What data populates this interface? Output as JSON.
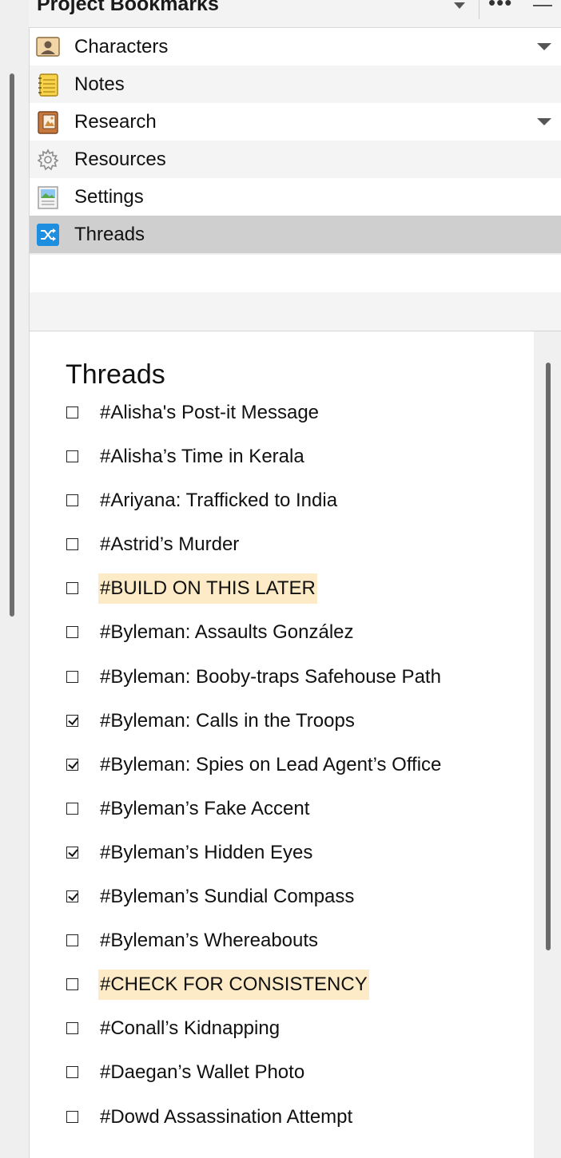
{
  "panel": {
    "title": "Project Bookmarks",
    "icons": [
      "chevron-down-icon",
      "more-icon",
      "minimize-icon"
    ]
  },
  "bookmarks": [
    {
      "label": "Characters",
      "icon": "character-card-icon",
      "has_dropdown": true
    },
    {
      "label": "Notes",
      "icon": "notepad-icon",
      "has_dropdown": false
    },
    {
      "label": "Research",
      "icon": "research-book-icon",
      "has_dropdown": true
    },
    {
      "label": "Resources",
      "icon": "gear-icon",
      "has_dropdown": false
    },
    {
      "label": "Settings",
      "icon": "settings-page-icon",
      "has_dropdown": false
    },
    {
      "label": "Threads",
      "icon": "shuffle-icon",
      "has_dropdown": false,
      "selected": true
    }
  ],
  "document": {
    "title": "Threads",
    "highlight_color": "#fdebc8",
    "threads": [
      {
        "label": "#Alisha's Post-it Message",
        "checked": false,
        "highlighted": false
      },
      {
        "label": "#Alisha’s Time in Kerala",
        "checked": false,
        "highlighted": false
      },
      {
        "label": "#Ariyana: Trafficked to India",
        "checked": false,
        "highlighted": false
      },
      {
        "label": "#Astrid’s Murder",
        "checked": false,
        "highlighted": false
      },
      {
        "label": "#BUILD ON THIS LATER",
        "checked": false,
        "highlighted": true
      },
      {
        "label": "#Byleman: Assaults González",
        "checked": false,
        "highlighted": false
      },
      {
        "label": "#Byleman: Booby-traps Safehouse Path",
        "checked": false,
        "highlighted": false
      },
      {
        "label": "#Byleman: Calls in the Troops",
        "checked": true,
        "highlighted": false
      },
      {
        "label": "#Byleman: Spies on Lead Agent’s Office",
        "checked": true,
        "highlighted": false
      },
      {
        "label": "#Byleman’s Fake Accent",
        "checked": false,
        "highlighted": false
      },
      {
        "label": "#Byleman’s Hidden Eyes",
        "checked": true,
        "highlighted": false
      },
      {
        "label": "#Byleman’s Sundial Compass",
        "checked": true,
        "highlighted": false
      },
      {
        "label": "#Byleman’s Whereabouts",
        "checked": false,
        "highlighted": false
      },
      {
        "label": "#CHECK FOR CONSISTENCY",
        "checked": false,
        "highlighted": true
      },
      {
        "label": "#Conall’s Kidnapping",
        "checked": false,
        "highlighted": false
      },
      {
        "label": "#Daegan’s Wallet Photo",
        "checked": false,
        "highlighted": false
      },
      {
        "label": "#Dowd Assassination Attempt",
        "checked": false,
        "highlighted": false
      }
    ]
  }
}
